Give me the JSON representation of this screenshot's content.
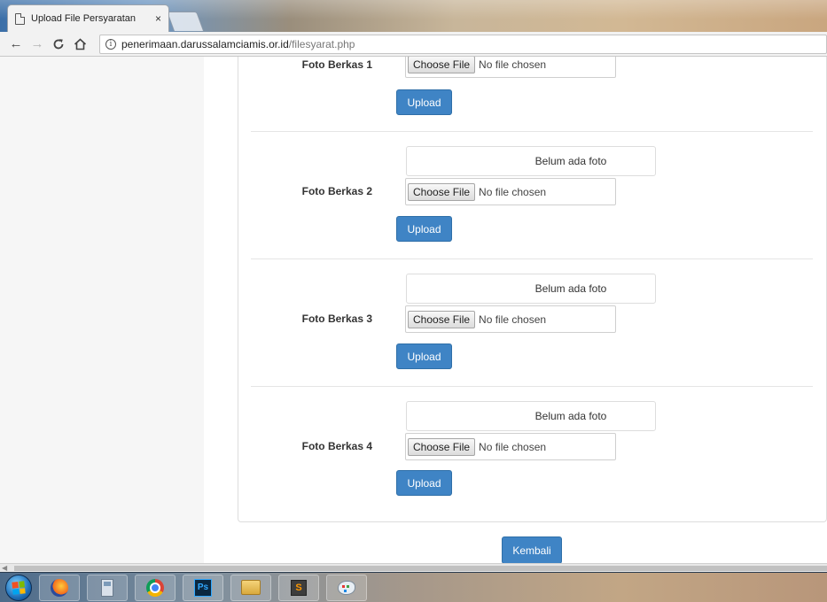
{
  "browser": {
    "tab_title": "Upload File Persyaratan",
    "tab_close": "×",
    "url_host": "penerimaan.darussalamciamis.or.id",
    "url_path": "/filesyarat.php",
    "icons": [
      "back-arrow-icon",
      "forward-arrow-icon",
      "reload-icon",
      "home-icon",
      "info-icon"
    ]
  },
  "form": {
    "items": [
      {
        "label": "Foto Berkas 1",
        "choose_label": "Choose File",
        "file_status": "No file chosen",
        "upload_label": "Upload"
      },
      {
        "label": "Foto Berkas 2",
        "preview_text": "Belum ada foto",
        "choose_label": "Choose File",
        "file_status": "No file chosen",
        "upload_label": "Upload"
      },
      {
        "label": "Foto Berkas 3",
        "preview_text": "Belum ada foto",
        "choose_label": "Choose File",
        "file_status": "No file chosen",
        "upload_label": "Upload"
      },
      {
        "label": "Foto Berkas 4",
        "preview_text": "Belum ada foto",
        "choose_label": "Choose File",
        "file_status": "No file chosen",
        "upload_label": "Upload"
      }
    ],
    "back_label": "Kembali",
    "button_color": "#3f84c5"
  },
  "taskbar": {
    "apps": [
      "firefox-icon",
      "calculator-icon",
      "chrome-icon",
      "photoshop-icon",
      "folder-icon",
      "sublime-text-icon",
      "paint-icon"
    ],
    "photoshop_text": "Ps",
    "sublime_text": "S"
  }
}
